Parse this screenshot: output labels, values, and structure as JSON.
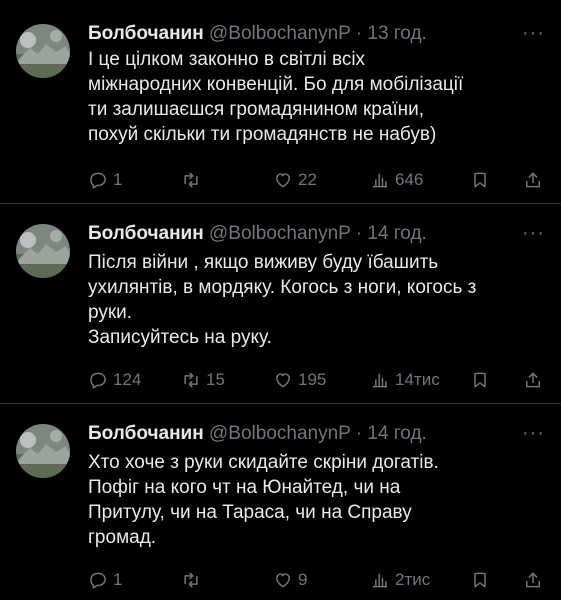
{
  "tweets": [
    {
      "author": "Болбочанин",
      "handle": "@BolbochanynP",
      "time": "13 год.",
      "text": "І це цілком законно в світлі всіх\nміжнародних конвенцій. Бо для мобілізації\nти залишаєшся громадянином країни,\nпохуй скільки ти громадянств не набув)",
      "replies": "1",
      "retweets": "",
      "likes": "22",
      "views": "646"
    },
    {
      "author": "Болбочанин",
      "handle": "@BolbochanynP",
      "time": "14 год.",
      "text": "Після війни , якщо виживу буду їбашить\nухилянтів, в мордяку. Когось з ноги, когось з\nруки.\nЗаписуйтесь на руку.",
      "replies": "124",
      "retweets": "15",
      "likes": "195",
      "views": "14тис"
    },
    {
      "author": "Болбочанин",
      "handle": "@BolbochanynP",
      "time": "14 год.",
      "text": "Хто хоче з руки скидайте скріни догатів.\nПофіг на кого чт на Юнайтед, чи на\nПритулу, чи на Тараса, чи на Справу\nгромад.",
      "replies": "1",
      "retweets": "",
      "likes": "9",
      "views": "2тис"
    }
  ],
  "separator": "·",
  "more_glyph": "···",
  "colors": {
    "background": "#000000",
    "text": "#e7e9ea",
    "muted": "#71767b",
    "divider": "#2f3336"
  },
  "icons": [
    "more-icon",
    "reply-icon",
    "retweet-icon",
    "like-icon",
    "views-icon",
    "bookmark-icon",
    "share-icon"
  ]
}
